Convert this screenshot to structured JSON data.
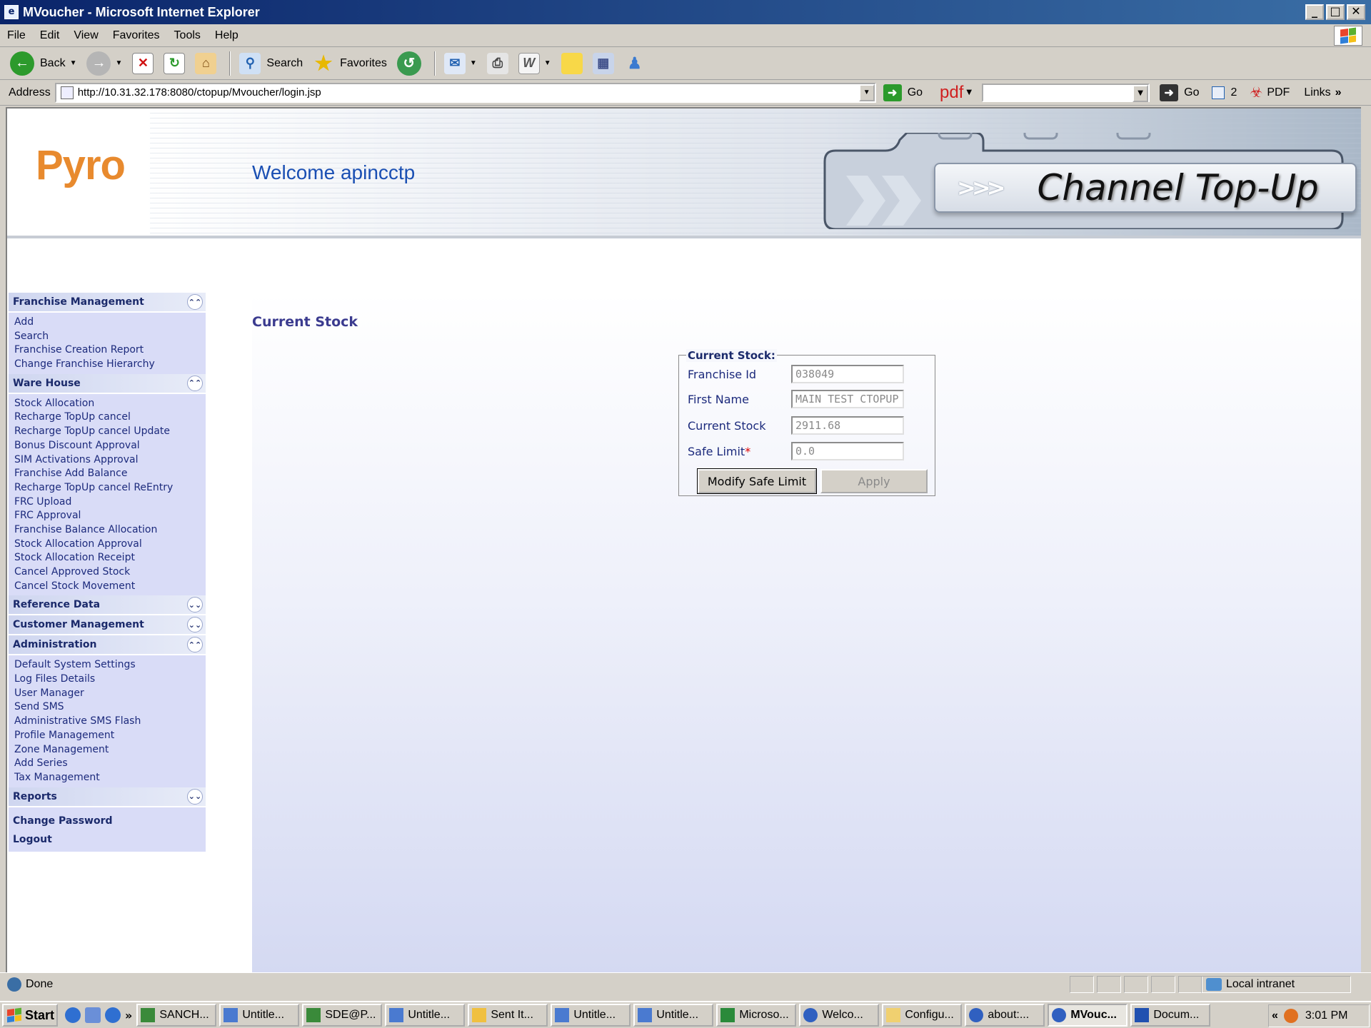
{
  "window": {
    "title": "MVoucher - Microsoft Internet Explorer",
    "min": "_",
    "max": "□",
    "close": "✕"
  },
  "menu": [
    "File",
    "Edit",
    "View",
    "Favorites",
    "Tools",
    "Help"
  ],
  "toolbar": {
    "back": "Back",
    "search": "Search",
    "favorites": "Favorites"
  },
  "address": {
    "label": "Address",
    "url": "http://10.31.32.178:8080/ctopup/Mvoucher/login.jsp",
    "go": "Go",
    "pdf": "pdf",
    "go2": "Go",
    "count": "2",
    "pdf_btn": "PDF",
    "links": "Links"
  },
  "banner": {
    "logo": "Pyro",
    "welcome": "Welcome apincctp",
    "product": "Channel Top-Up"
  },
  "sidebar": {
    "sections": [
      {
        "title": "Franchise Management",
        "expanded": true,
        "items": [
          "Add",
          "Search",
          "Franchise Creation Report",
          "Change Franchise Hierarchy"
        ]
      },
      {
        "title": "Ware House",
        "expanded": true,
        "items": [
          "Stock Allocation",
          "Recharge TopUp cancel",
          "Recharge TopUp cancel Update",
          "Bonus Discount Approval",
          "SIM Activations Approval",
          "Franchise Add Balance",
          "Recharge TopUp cancel ReEntry",
          "FRC Upload",
          "FRC Approval",
          "Franchise Balance Allocation",
          "Stock Allocation Approval",
          "Stock Allocation Receipt",
          "Cancel Approved Stock",
          "Cancel Stock Movement"
        ]
      },
      {
        "title": "Reference Data",
        "expanded": false,
        "items": []
      },
      {
        "title": "Customer Management",
        "expanded": false,
        "items": []
      },
      {
        "title": "Administration",
        "expanded": true,
        "items": [
          "Default System Settings",
          "Log Files Details",
          "User Manager",
          "Send SMS",
          "Administrative SMS Flash",
          "Profile Management",
          "Zone Management",
          "Add Series",
          "Tax Management"
        ]
      },
      {
        "title": "Reports",
        "expanded": false,
        "items": []
      }
    ],
    "change_password": "Change Password",
    "logout": "Logout"
  },
  "main": {
    "title": "Current Stock",
    "legend": "Current Stock:",
    "fields": {
      "franchise_id": {
        "label": "Franchise Id",
        "value": "038049"
      },
      "first_name": {
        "label": "First Name",
        "value": "MAIN TEST CTOPUP"
      },
      "current_stock": {
        "label": "Current Stock",
        "value": "2911.68"
      },
      "safe_limit": {
        "label": "Safe Limit",
        "required": "*",
        "value": "0.0"
      }
    },
    "modify_button": "Modify Safe Limit",
    "apply_button": "Apply"
  },
  "status": {
    "text": "Done",
    "zone": "Local intranet"
  },
  "taskbar": {
    "start": "Start",
    "tasks": [
      "SANCH...",
      "Untitle...",
      "SDE@P...",
      "Untitle...",
      "Sent It...",
      "Untitle...",
      "Untitle...",
      "Microso...",
      "Welco...",
      "Configu...",
      "about:...",
      "MVouc...",
      "Docum..."
    ],
    "active_index": 11,
    "clock": "3:01 PM"
  }
}
